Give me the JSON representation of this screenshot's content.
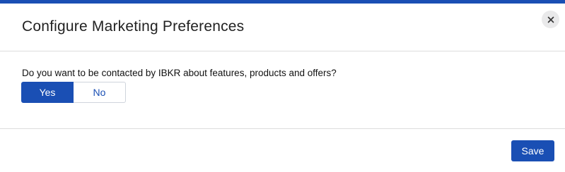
{
  "modal": {
    "title": "Configure Marketing Preferences",
    "close_icon": "close-icon",
    "accent_color": "#1a4fb4"
  },
  "question": {
    "text": "Do you want to be contacted by IBKR about features, products and offers?"
  },
  "toggle": {
    "options": [
      "Yes",
      "No"
    ],
    "selected": "Yes"
  },
  "footer": {
    "save_label": "Save"
  }
}
